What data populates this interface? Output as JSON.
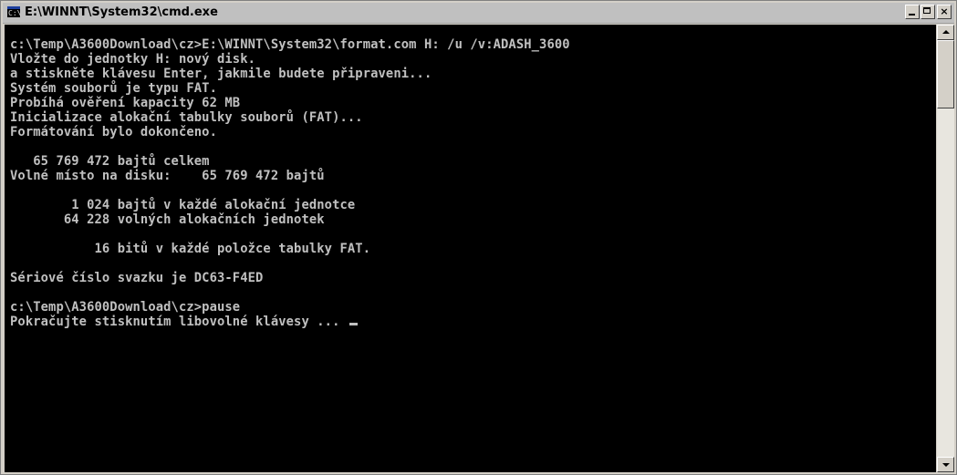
{
  "window": {
    "title": "E:\\WINNT\\System32\\cmd.exe",
    "icon": "console-icon",
    "controls": {
      "minimize": "minimize-icon",
      "maximize": "maximize-icon",
      "close": "×"
    }
  },
  "console": {
    "lines": [
      "c:\\Temp\\A3600Download\\cz>E:\\WINNT\\System32\\format.com H: /u /v:ADASH_3600",
      "Vložte do jednotky H: nový disk.",
      "a stiskněte klávesu Enter, jakmile budete připraveni...",
      "Systém souborů je typu FAT.",
      "Probíhá ověření kapacity 62 MB",
      "Inicializace alokační tabulky souborů (FAT)...",
      "Formátování bylo dokončeno.",
      "",
      "   65 769 472 bajtů celkem",
      "Volné místo na disku:    65 769 472 bajtů",
      "",
      "        1 024 bajtů v každé alokační jednotce",
      "       64 228 volných alokačních jednotek",
      "",
      "           16 bitů v každé položce tabulky FAT.",
      "",
      "Sériové číslo svazku je DC63-F4ED",
      "",
      "c:\\Temp\\A3600Download\\cz>pause",
      "Pokračujte stisknutím libovolné klávesy ... "
    ]
  },
  "colors": {
    "console_bg": "#000000",
    "console_fg": "#c0c0c0",
    "chrome": "#d4d0c8"
  }
}
